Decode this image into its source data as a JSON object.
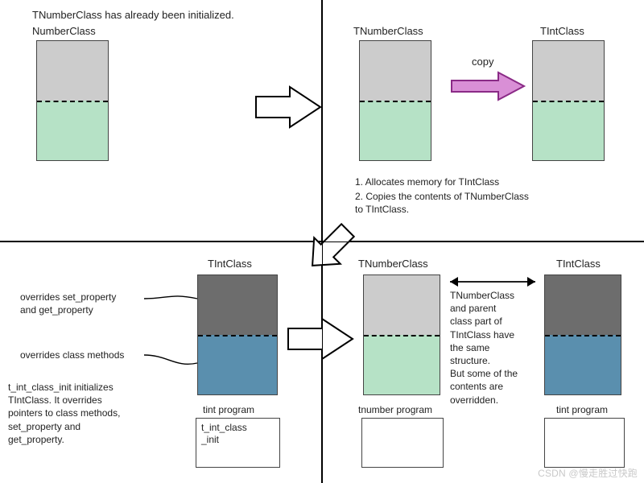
{
  "q1": {
    "header": "TNumberClass has already been initialized.",
    "box_label": "NumberClass"
  },
  "q2": {
    "left_label": "TNumberClass",
    "right_label": "TIntClass",
    "copy_label": "copy",
    "step1": "1. Allocates memory for TIntClass",
    "step2": "2. Copies the contents of TNumberClass\n    to TIntClass."
  },
  "q3": {
    "box_label": "TIntClass",
    "ov1": "overrides set_property\nand get_property",
    "ov2": "overrides class methods",
    "para": "t_int_class_init initializes\nTIntClass. It overrides\npointers to class methods,\nset_property and\nget_property.",
    "prog_title": "tint program",
    "prog_body": "t_int_class\n_init"
  },
  "q4": {
    "left_label": "TNumberClass",
    "right_label": "TIntClass",
    "mid_text": "TNumberClass\nand parent\nclass part of\nTIntClass have\nthe same\nstructure.\nBut some of the\ncontents are\noverridden.",
    "prog_left": "tnumber program",
    "prog_right": "tint program"
  },
  "watermark": "CSDN @慢走胜过快跑"
}
